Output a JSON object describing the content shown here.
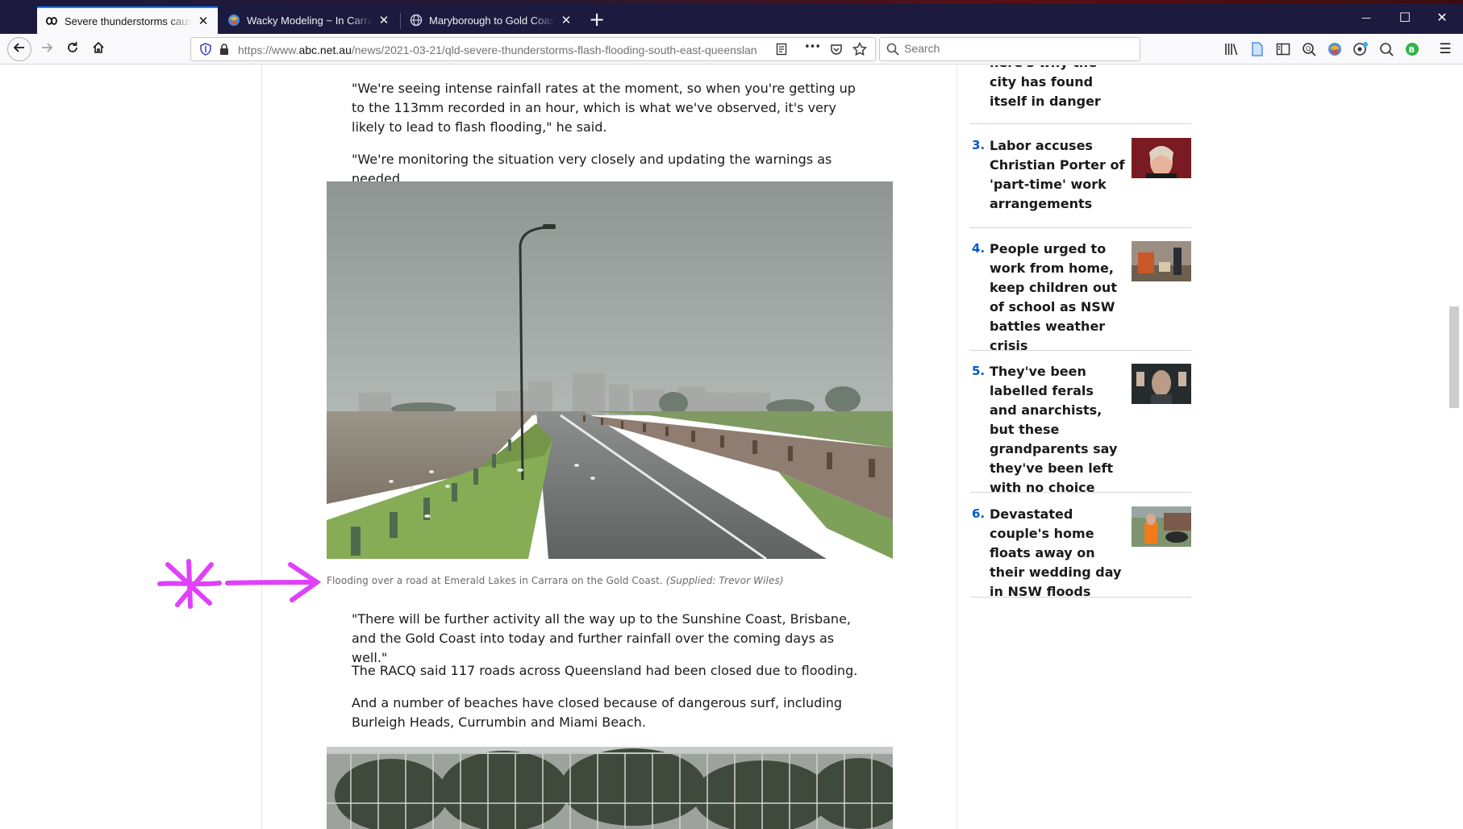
{
  "browser": {
    "tabs": [
      {
        "title": "Severe thunderstorms cause fla",
        "active": true
      },
      {
        "title": "Wacky Modeling ~ In Carrara ~",
        "active": false
      },
      {
        "title": "Maryborough to Gold Coast Ra",
        "active": false
      }
    ],
    "url_prefix": "https://www.",
    "url_domain": "abc.net.au",
    "url_path": "/news/2021-03-21/qld-severe-thunderstorms-flash-flooding-south-east-queenslan",
    "search_placeholder": "Search",
    "new_tab": "+",
    "close_glyph": "✕",
    "minimize_glyph": "—",
    "maximize_glyph": "☐",
    "window_close_glyph": "✕",
    "menu_glyph": "☰",
    "overflow_glyph": "•••",
    "accent_color": "#0a84ff"
  },
  "article": {
    "para1": "\"We're seeing intense rainfall rates at the moment, so when you're getting up to the 113mm recorded in an hour, which is what we've observed, it's very likely to lead to flash flooding,\" he said.",
    "para2": "\"We're monitoring the situation very closely and updating the warnings as needed.",
    "caption_text": "Flooding over a road at Emerald Lakes in Carrara on the Gold Coast.",
    "caption_credit": "(Supplied: Trevor Wiles)",
    "para3": "\"There will be further activity all the way up to the Sunshine Coast, Brisbane, and the Gold Coast into today and further rainfall over the coming days as well.\"",
    "para4": "The RACQ said 117 roads across Queensland had been closed due to flooding.",
    "para5": "And a number of beaches have closed because of dangerous surf, including Burleigh Heads, Currumbin and Miami Beach."
  },
  "sidebar": {
    "item2_tail": "here's why the city has found itself in danger",
    "items": [
      {
        "num": "3.",
        "title": "Labor accuses Christian Porter of 'part-time' work arrangements"
      },
      {
        "num": "4.",
        "title": "People urged to work from home, keep children out of school as NSW battles weather crisis"
      },
      {
        "num": "5.",
        "title": "They've been labelled ferals and anarchists, but these grandparents say they've been left with no choice"
      },
      {
        "num": "6.",
        "title": "Devastated couple's home floats away on their wedding day in NSW floods"
      }
    ],
    "number_color": "#0058cc"
  },
  "annotation": {
    "color": "#e040fb"
  }
}
